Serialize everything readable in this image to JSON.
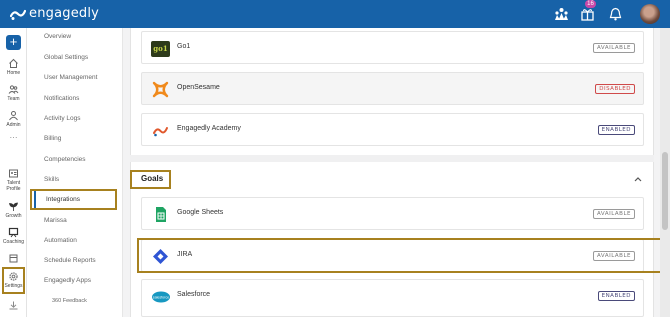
{
  "app": {
    "brand": "engagedly"
  },
  "topbar": {
    "notifications_badge": "16"
  },
  "leftnav": {
    "items": [
      {
        "label": "Home",
        "icon": "home-icon"
      },
      {
        "label": "Team",
        "icon": "team-icon"
      },
      {
        "label": "Admin",
        "icon": "admin-icon"
      },
      {
        "label": "···",
        "icon": "more-icon"
      },
      {
        "label": "Talent Profile",
        "icon": "profile-icon"
      },
      {
        "label": "Growth",
        "icon": "growth-icon"
      },
      {
        "label": "Coaching",
        "icon": "coaching-icon"
      },
      {
        "label": "",
        "icon": "calendar-icon"
      },
      {
        "label": "Settings",
        "icon": "settings-icon"
      },
      {
        "label": "",
        "icon": "download-icon"
      }
    ]
  },
  "menu": {
    "items": [
      "Overview",
      "Global Settings",
      "User Management",
      "Notifications",
      "Activity Logs",
      "Billing",
      "Competencies",
      "Skills",
      "Integrations",
      "Marissa",
      "Automation",
      "Schedule Reports",
      "Engagedly Apps",
      "360 Feedback"
    ],
    "active": "Integrations"
  },
  "integrations_top": [
    {
      "name": "Go1",
      "status": "AVAILABLE"
    },
    {
      "name": "OpenSesame",
      "status": "DISABLED"
    },
    {
      "name": "Engagedly Academy",
      "status": "ENABLED"
    }
  ],
  "goals": {
    "title": "Goals",
    "items": [
      {
        "name": "Google Sheets",
        "status": "AVAILABLE"
      },
      {
        "name": "JIRA",
        "status": "AVAILABLE"
      },
      {
        "name": "Salesforce",
        "status": "ENABLED"
      }
    ]
  },
  "colors": {
    "brand": "#1762a8",
    "highlight": "#a7811f",
    "disabled": "#d04a4a"
  }
}
